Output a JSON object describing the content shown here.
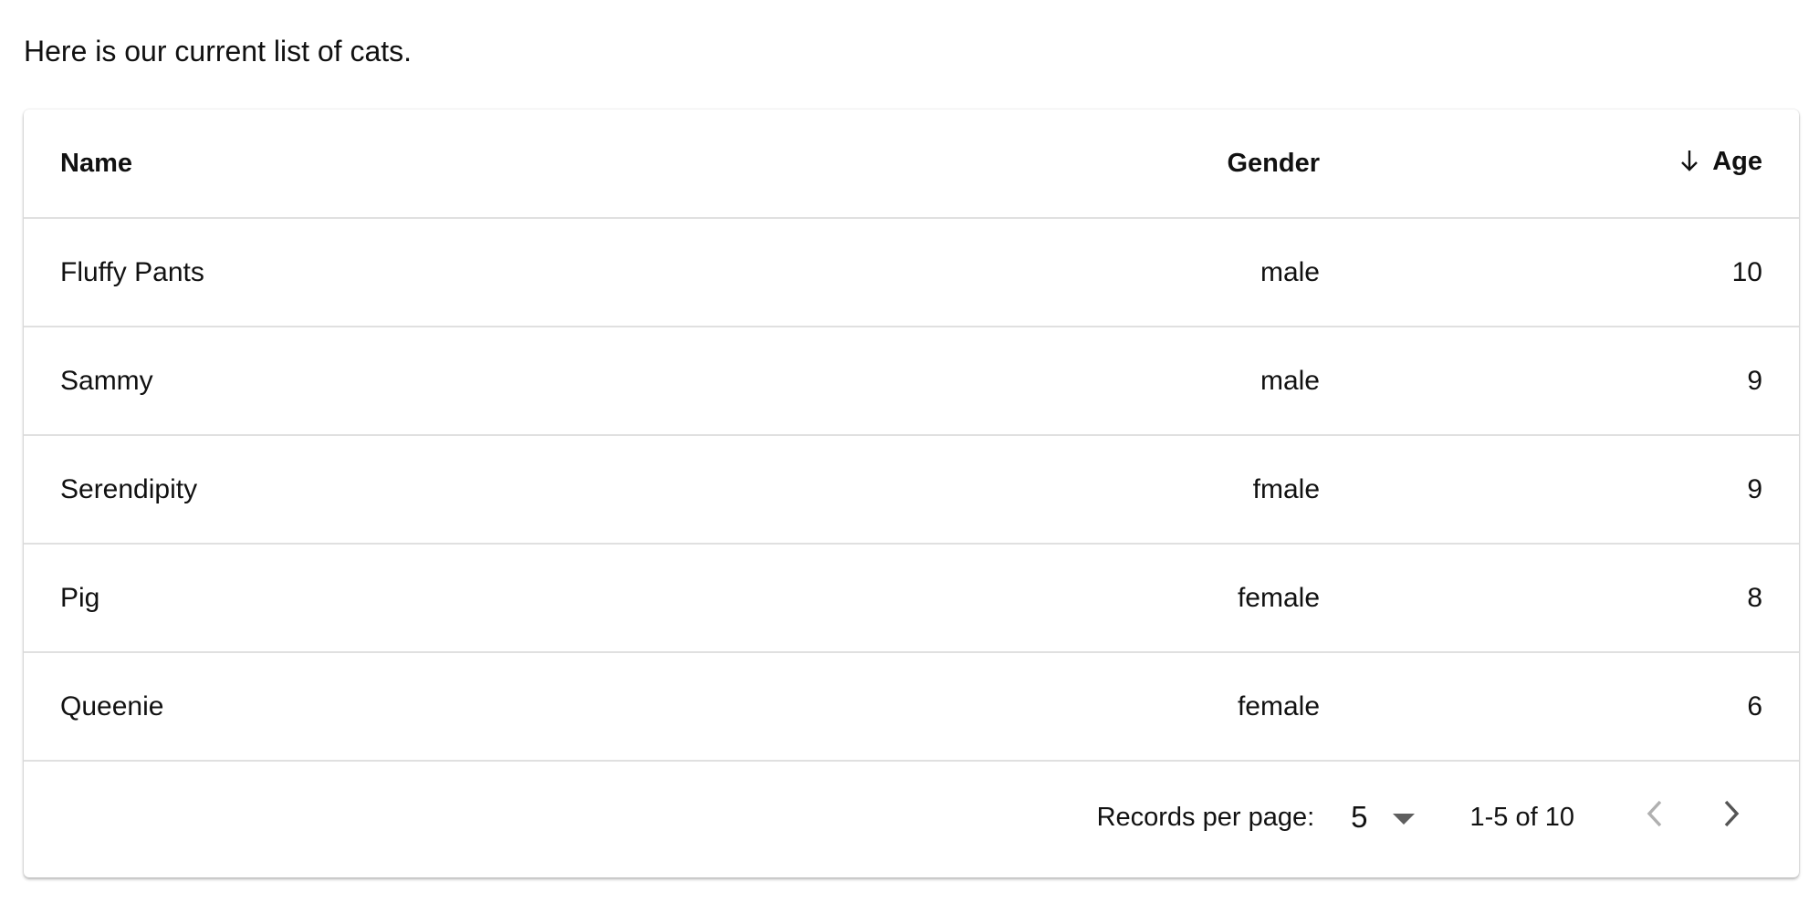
{
  "intro_text": "Here is our current list of cats.",
  "table": {
    "columns": {
      "name": "Name",
      "gender": "Gender",
      "age": "Age"
    },
    "sort": {
      "column": "age",
      "direction": "descending"
    },
    "rows": [
      {
        "name": "Fluffy Pants",
        "gender": "male",
        "age": "10"
      },
      {
        "name": "Sammy",
        "gender": "male",
        "age": "9"
      },
      {
        "name": "Serendipity",
        "gender": "fmale",
        "age": "9"
      },
      {
        "name": "Pig",
        "gender": "female",
        "age": "8"
      },
      {
        "name": "Queenie",
        "gender": "female",
        "age": "6"
      }
    ]
  },
  "pagination": {
    "records_per_page_label": "Records per page:",
    "records_per_page_value": "5",
    "range_text": "1-5 of 10",
    "prev_icon": "chevron-left-icon",
    "next_icon": "chevron-right-icon"
  },
  "colors": {
    "text": "#111111",
    "divider": "#e0e0e0",
    "icon_disabled": "#b0b0b0",
    "icon_active": "#555555"
  }
}
